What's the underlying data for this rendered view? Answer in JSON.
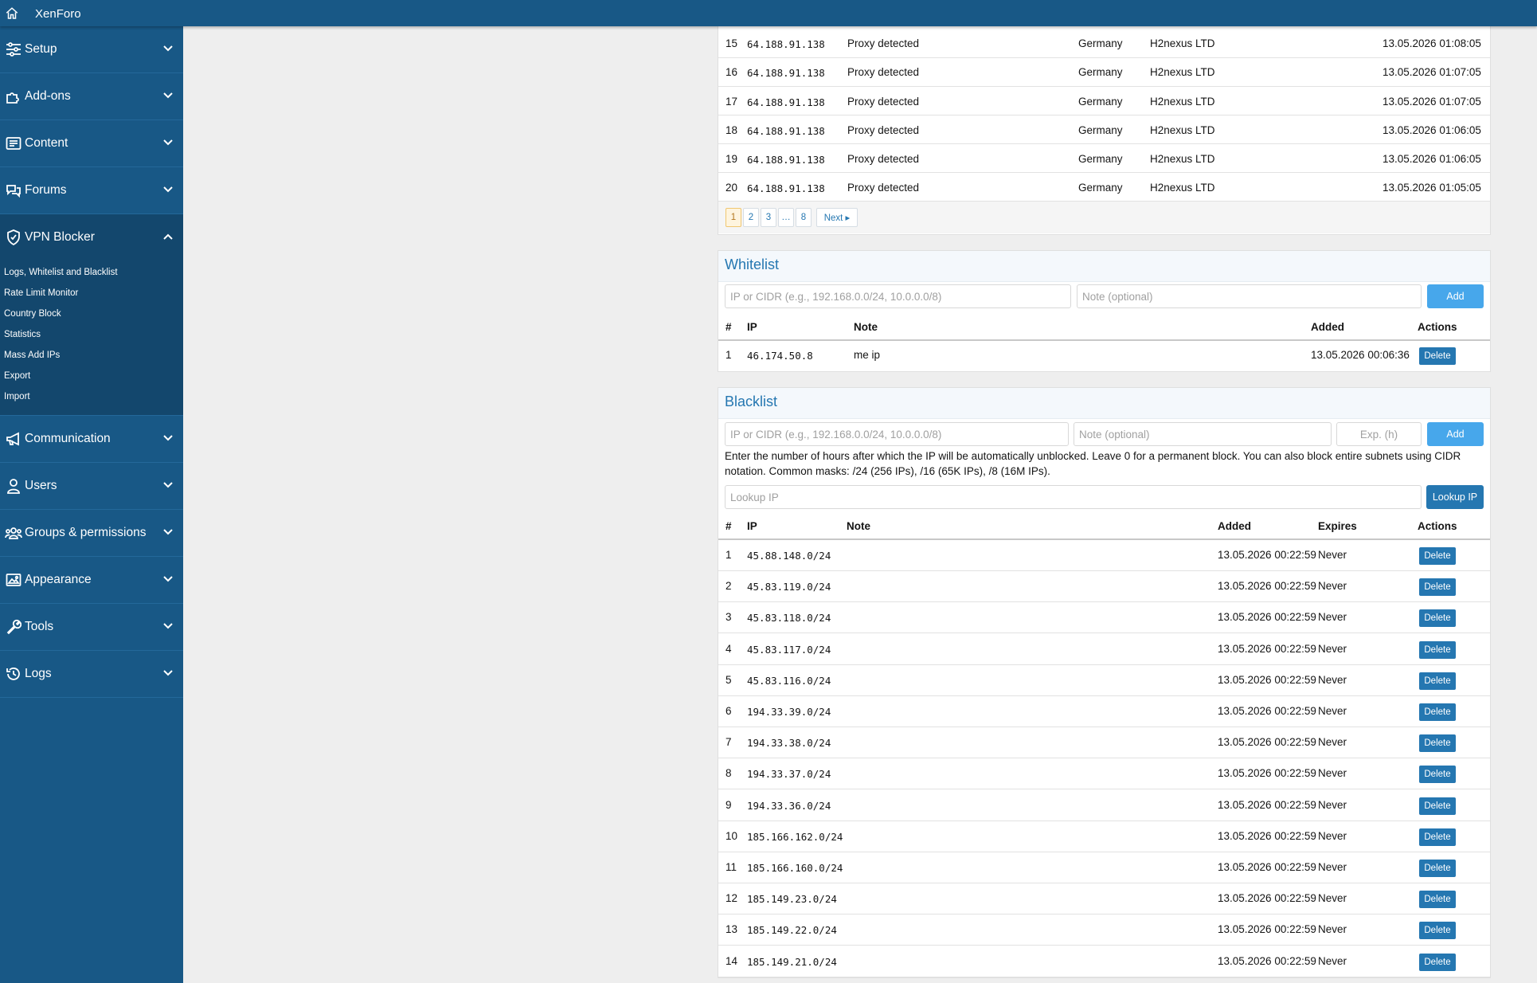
{
  "app": {
    "title": "XenForo"
  },
  "sidebar": {
    "items": [
      {
        "label": "Setup",
        "icon": "sliders-icon"
      },
      {
        "label": "Add-ons",
        "icon": "puzzle-icon"
      },
      {
        "label": "Content",
        "icon": "newspaper-icon"
      },
      {
        "label": "Forums",
        "icon": "comments-icon"
      },
      {
        "label": "VPN Blocker",
        "icon": "shield-icon"
      },
      {
        "label": "Communication",
        "icon": "megaphone-icon"
      },
      {
        "label": "Users",
        "icon": "user-icon"
      },
      {
        "label": "Groups & permissions",
        "icon": "users-icon"
      },
      {
        "label": "Appearance",
        "icon": "image-icon"
      },
      {
        "label": "Tools",
        "icon": "wrench-icon"
      },
      {
        "label": "Logs",
        "icon": "history-icon"
      }
    ],
    "vpn_sub": [
      "Logs, Whitelist and Blacklist",
      "Rate Limit Monitor",
      "Country Block",
      "Statistics",
      "Mass Add IPs",
      "Export",
      "Import"
    ]
  },
  "logs": {
    "rows": [
      {
        "n": "15",
        "ip": "64.188.91.138",
        "reason": "Proxy detected",
        "country": "Germany",
        "isp": "H2nexus LTD",
        "date": "13.05.2026 01:08:05"
      },
      {
        "n": "16",
        "ip": "64.188.91.138",
        "reason": "Proxy detected",
        "country": "Germany",
        "isp": "H2nexus LTD",
        "date": "13.05.2026 01:07:05"
      },
      {
        "n": "17",
        "ip": "64.188.91.138",
        "reason": "Proxy detected",
        "country": "Germany",
        "isp": "H2nexus LTD",
        "date": "13.05.2026 01:07:05"
      },
      {
        "n": "18",
        "ip": "64.188.91.138",
        "reason": "Proxy detected",
        "country": "Germany",
        "isp": "H2nexus LTD",
        "date": "13.05.2026 01:06:05"
      },
      {
        "n": "19",
        "ip": "64.188.91.138",
        "reason": "Proxy detected",
        "country": "Germany",
        "isp": "H2nexus LTD",
        "date": "13.05.2026 01:06:05"
      },
      {
        "n": "20",
        "ip": "64.188.91.138",
        "reason": "Proxy detected",
        "country": "Germany",
        "isp": "H2nexus LTD",
        "date": "13.05.2026 01:05:05"
      }
    ],
    "pager": {
      "pages": [
        "1",
        "2",
        "3",
        "…",
        "8"
      ],
      "next": "Next ▸"
    }
  },
  "whitelist": {
    "title": "Whitelist",
    "ip_placeholder": "IP or CIDR (e.g., 192.168.0.0/24, 10.0.0.0/8)",
    "note_placeholder": "Note (optional)",
    "add_label": "Add",
    "headers": {
      "num": "#",
      "ip": "IP",
      "note": "Note",
      "added": "Added",
      "actions": "Actions"
    },
    "rows": [
      {
        "n": "1",
        "ip": "46.174.50.8",
        "note": "me ip",
        "added": "13.05.2026 00:06:36",
        "action": "Delete"
      }
    ]
  },
  "blacklist": {
    "title": "Blacklist",
    "ip_placeholder": "IP or CIDR (e.g., 192.168.0.0/24, 10.0.0.0/8)",
    "note_placeholder": "Note (optional)",
    "exp_placeholder": "Exp. (h)",
    "add_label": "Add",
    "hint": "Enter the number of hours after which the IP will be automatically unblocked. Leave 0 for a permanent block. You can also block entire subnets using CIDR notation. Common masks: /24 (256 IPs), /16 (65K IPs), /8 (16M IPs).",
    "lookup_placeholder": "Lookup IP",
    "lookup_label": "Lookup IP",
    "headers": {
      "num": "#",
      "ip": "IP",
      "note": "Note",
      "added": "Added",
      "expires": "Expires",
      "actions": "Actions"
    },
    "delete_label": "Delete",
    "rows": [
      {
        "n": "1",
        "ip": "45.88.148.0/24",
        "added": "13.05.2026 00:22:59",
        "expires": "Never"
      },
      {
        "n": "2",
        "ip": "45.83.119.0/24",
        "added": "13.05.2026 00:22:59",
        "expires": "Never"
      },
      {
        "n": "3",
        "ip": "45.83.118.0/24",
        "added": "13.05.2026 00:22:59",
        "expires": "Never"
      },
      {
        "n": "4",
        "ip": "45.83.117.0/24",
        "added": "13.05.2026 00:22:59",
        "expires": "Never"
      },
      {
        "n": "5",
        "ip": "45.83.116.0/24",
        "added": "13.05.2026 00:22:59",
        "expires": "Never"
      },
      {
        "n": "6",
        "ip": "194.33.39.0/24",
        "added": "13.05.2026 00:22:59",
        "expires": "Never"
      },
      {
        "n": "7",
        "ip": "194.33.38.0/24",
        "added": "13.05.2026 00:22:59",
        "expires": "Never"
      },
      {
        "n": "8",
        "ip": "194.33.37.0/24",
        "added": "13.05.2026 00:22:59",
        "expires": "Never"
      },
      {
        "n": "9",
        "ip": "194.33.36.0/24",
        "added": "13.05.2026 00:22:59",
        "expires": "Never"
      },
      {
        "n": "10",
        "ip": "185.166.162.0/24",
        "added": "13.05.2026 00:22:59",
        "expires": "Never"
      },
      {
        "n": "11",
        "ip": "185.166.160.0/24",
        "added": "13.05.2026 00:22:59",
        "expires": "Never"
      },
      {
        "n": "12",
        "ip": "185.149.23.0/24",
        "added": "13.05.2026 00:22:59",
        "expires": "Never"
      },
      {
        "n": "13",
        "ip": "185.149.22.0/24",
        "added": "13.05.2026 00:22:59",
        "expires": "Never"
      },
      {
        "n": "14",
        "ip": "185.149.21.0/24",
        "added": "13.05.2026 00:22:59",
        "expires": "Never"
      }
    ]
  },
  "colors": {
    "brand": "#185886",
    "link": "#2577b1",
    "button": "#2577b1",
    "primary_button": "#47a7eb"
  }
}
